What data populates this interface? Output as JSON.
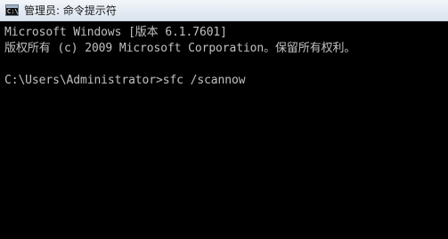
{
  "window": {
    "title": "管理员: 命令提示符",
    "icon": "cmd-console-icon",
    "icon_glyph": "C:\\"
  },
  "console": {
    "lines": [
      "Microsoft Windows [版本 6.1.7601]",
      "版权所有 (c) 2009 Microsoft Corporation。保留所有权利。",
      "C:\\Users\\Administrator>sfc /scannow"
    ]
  },
  "colors": {
    "background": "#000000",
    "text": "#c0c0c0",
    "titlebar": "#e4ebf3"
  }
}
